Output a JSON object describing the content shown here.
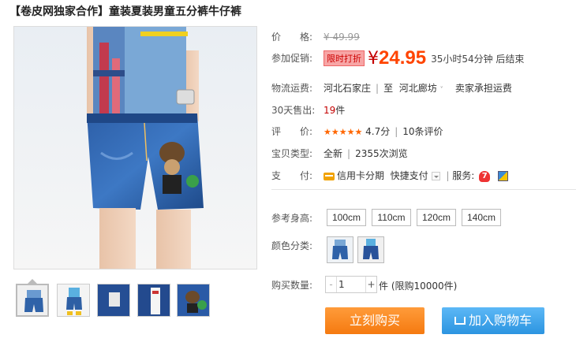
{
  "title": "【卷皮网独家合作】童装夏装男童五分裤牛仔裤",
  "price": {
    "label": "价　　格:",
    "currency": "¥",
    "original": "49.99"
  },
  "promo": {
    "label": "参加促销:",
    "badge": "限时打折",
    "currency": "¥",
    "price": "24.95",
    "countdown": "35小时54分钟 后结束"
  },
  "shipping": {
    "label": "物流运费:",
    "from": "河北石家庄",
    "to_prefix": "至",
    "to": "河北廊坊",
    "fee": "卖家承担运费"
  },
  "sales": {
    "label": "30天售出:",
    "count": "19",
    "unit": "件"
  },
  "rating": {
    "label": "评　　价:",
    "stars": "★★★★★",
    "score": "4.7分",
    "reviews": "10条评价"
  },
  "product_type": {
    "label": "宝贝类型:",
    "condition": "全新",
    "views": "2355次浏览"
  },
  "payment": {
    "label": "支　　付:",
    "method": "信用卡分期",
    "quick": "快捷支付",
    "service_label": "服务:",
    "service_badge": "7"
  },
  "sizes": {
    "label": "参考身高:",
    "options": [
      "100cm",
      "110cm",
      "120cm",
      "140cm"
    ]
  },
  "colors": {
    "label": "颜色分类:"
  },
  "quantity": {
    "label": "购买数量:",
    "minus": "-",
    "value": "1",
    "plus": "+",
    "limit": "件 (限购10000件)"
  },
  "actions": {
    "buy": "立刻购买",
    "cart": "加入购物车"
  },
  "thumbnails_count": 5,
  "colors_palette": {
    "price_red": "#f40",
    "buy_orange": "#f57a10",
    "cart_blue": "#2c94e0",
    "badge_red": "#c40000"
  }
}
